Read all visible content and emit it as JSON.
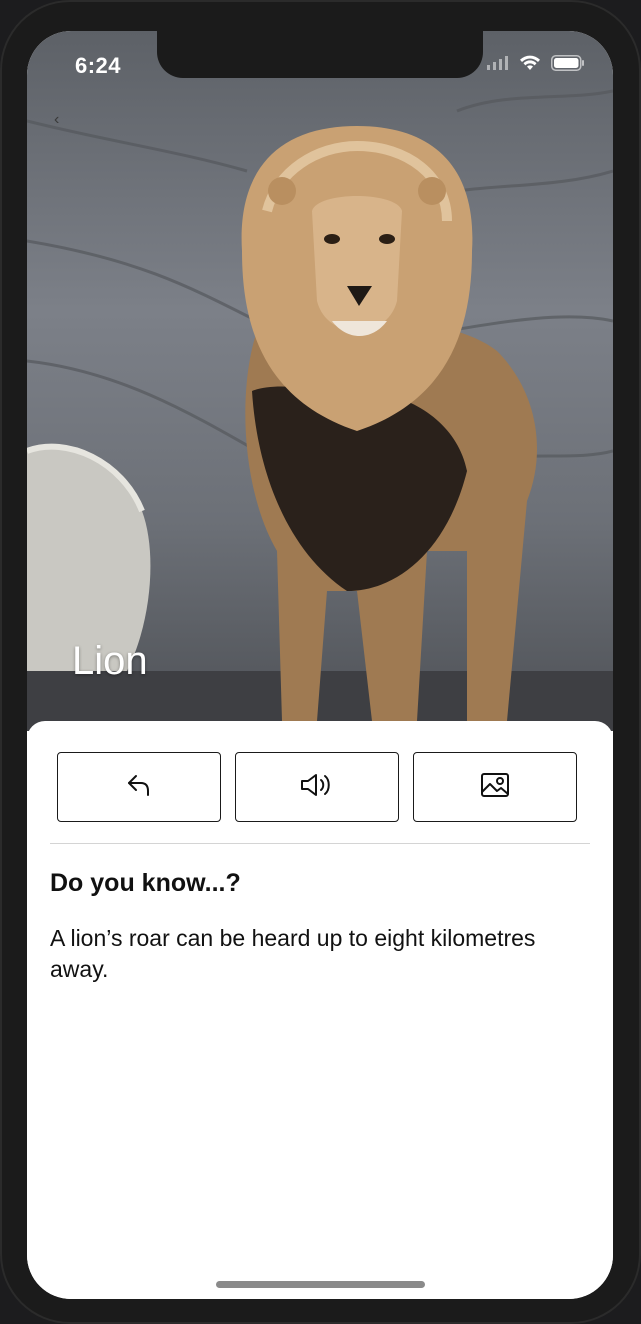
{
  "status_bar": {
    "time": "6:24",
    "icons": [
      "signal-icon",
      "wifi-icon",
      "battery-icon"
    ]
  },
  "nav": {
    "back_icon": "chevron-left-icon",
    "back_glyph": "‹"
  },
  "hero": {
    "animal_name": "Lion",
    "image_subject": "lion-photo"
  },
  "actions": [
    {
      "name": "back-action",
      "icon": "return-arrow-icon"
    },
    {
      "name": "sound-action",
      "icon": "speaker-icon"
    },
    {
      "name": "photo-action",
      "icon": "image-icon"
    }
  ],
  "fact": {
    "heading": "Do you know...?",
    "text": "A lion’s roar can be heard up to eight kilometres away."
  },
  "colors": {
    "text": "#111111",
    "button_border": "#1a1a1a",
    "panel_bg": "#ffffff"
  }
}
